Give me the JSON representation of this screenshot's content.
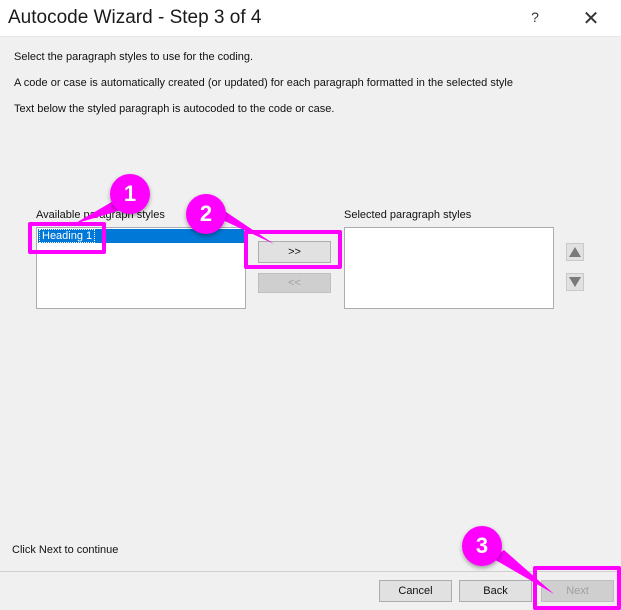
{
  "window": {
    "title": "Autocode Wizard - Step 3 of 4",
    "help_glyph": "?",
    "close_glyph": "✕"
  },
  "instructions": [
    "Select the paragraph styles to use for the coding.",
    "A code or case is automatically created (or updated) for each paragraph formatted in the selected style",
    "Text below the styled paragraph is autocoded to the code or case."
  ],
  "available": {
    "label": "Available paragraph styles",
    "items": [
      "Heading 1"
    ]
  },
  "selected": {
    "label": "Selected paragraph styles",
    "items": []
  },
  "transfer": {
    "add_label": ">>",
    "remove_label": "<<"
  },
  "reorder": {
    "up_icon": "triangle-up-icon",
    "down_icon": "triangle-down-icon"
  },
  "status_text": "Click Next to continue",
  "footer": {
    "cancel_label": "Cancel",
    "back_label": "Back",
    "next_label": "Next"
  },
  "callouts": [
    {
      "number": "1"
    },
    {
      "number": "2"
    },
    {
      "number": "3"
    }
  ],
  "colors": {
    "highlight": "#ff00ff",
    "selection": "#0078d7",
    "panel": "#f0f0f0"
  }
}
